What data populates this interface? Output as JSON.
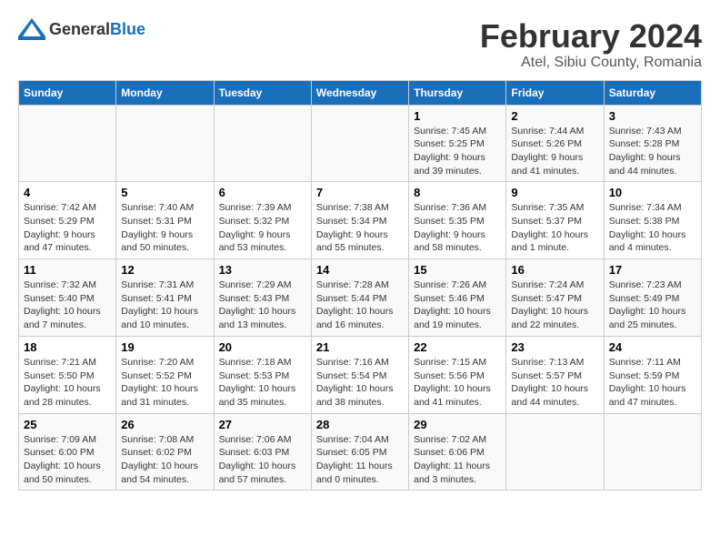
{
  "header": {
    "logo_general": "General",
    "logo_blue": "Blue",
    "title": "February 2024",
    "subtitle": "Atel, Sibiu County, Romania"
  },
  "days_of_week": [
    "Sunday",
    "Monday",
    "Tuesday",
    "Wednesday",
    "Thursday",
    "Friday",
    "Saturday"
  ],
  "weeks": [
    [
      {
        "day": "",
        "info": ""
      },
      {
        "day": "",
        "info": ""
      },
      {
        "day": "",
        "info": ""
      },
      {
        "day": "",
        "info": ""
      },
      {
        "day": "1",
        "info": "Sunrise: 7:45 AM\nSunset: 5:25 PM\nDaylight: 9 hours\nand 39 minutes."
      },
      {
        "day": "2",
        "info": "Sunrise: 7:44 AM\nSunset: 5:26 PM\nDaylight: 9 hours\nand 41 minutes."
      },
      {
        "day": "3",
        "info": "Sunrise: 7:43 AM\nSunset: 5:28 PM\nDaylight: 9 hours\nand 44 minutes."
      }
    ],
    [
      {
        "day": "4",
        "info": "Sunrise: 7:42 AM\nSunset: 5:29 PM\nDaylight: 9 hours\nand 47 minutes."
      },
      {
        "day": "5",
        "info": "Sunrise: 7:40 AM\nSunset: 5:31 PM\nDaylight: 9 hours\nand 50 minutes."
      },
      {
        "day": "6",
        "info": "Sunrise: 7:39 AM\nSunset: 5:32 PM\nDaylight: 9 hours\nand 53 minutes."
      },
      {
        "day": "7",
        "info": "Sunrise: 7:38 AM\nSunset: 5:34 PM\nDaylight: 9 hours\nand 55 minutes."
      },
      {
        "day": "8",
        "info": "Sunrise: 7:36 AM\nSunset: 5:35 PM\nDaylight: 9 hours\nand 58 minutes."
      },
      {
        "day": "9",
        "info": "Sunrise: 7:35 AM\nSunset: 5:37 PM\nDaylight: 10 hours\nand 1 minute."
      },
      {
        "day": "10",
        "info": "Sunrise: 7:34 AM\nSunset: 5:38 PM\nDaylight: 10 hours\nand 4 minutes."
      }
    ],
    [
      {
        "day": "11",
        "info": "Sunrise: 7:32 AM\nSunset: 5:40 PM\nDaylight: 10 hours\nand 7 minutes."
      },
      {
        "day": "12",
        "info": "Sunrise: 7:31 AM\nSunset: 5:41 PM\nDaylight: 10 hours\nand 10 minutes."
      },
      {
        "day": "13",
        "info": "Sunrise: 7:29 AM\nSunset: 5:43 PM\nDaylight: 10 hours\nand 13 minutes."
      },
      {
        "day": "14",
        "info": "Sunrise: 7:28 AM\nSunset: 5:44 PM\nDaylight: 10 hours\nand 16 minutes."
      },
      {
        "day": "15",
        "info": "Sunrise: 7:26 AM\nSunset: 5:46 PM\nDaylight: 10 hours\nand 19 minutes."
      },
      {
        "day": "16",
        "info": "Sunrise: 7:24 AM\nSunset: 5:47 PM\nDaylight: 10 hours\nand 22 minutes."
      },
      {
        "day": "17",
        "info": "Sunrise: 7:23 AM\nSunset: 5:49 PM\nDaylight: 10 hours\nand 25 minutes."
      }
    ],
    [
      {
        "day": "18",
        "info": "Sunrise: 7:21 AM\nSunset: 5:50 PM\nDaylight: 10 hours\nand 28 minutes."
      },
      {
        "day": "19",
        "info": "Sunrise: 7:20 AM\nSunset: 5:52 PM\nDaylight: 10 hours\nand 31 minutes."
      },
      {
        "day": "20",
        "info": "Sunrise: 7:18 AM\nSunset: 5:53 PM\nDaylight: 10 hours\nand 35 minutes."
      },
      {
        "day": "21",
        "info": "Sunrise: 7:16 AM\nSunset: 5:54 PM\nDaylight: 10 hours\nand 38 minutes."
      },
      {
        "day": "22",
        "info": "Sunrise: 7:15 AM\nSunset: 5:56 PM\nDaylight: 10 hours\nand 41 minutes."
      },
      {
        "day": "23",
        "info": "Sunrise: 7:13 AM\nSunset: 5:57 PM\nDaylight: 10 hours\nand 44 minutes."
      },
      {
        "day": "24",
        "info": "Sunrise: 7:11 AM\nSunset: 5:59 PM\nDaylight: 10 hours\nand 47 minutes."
      }
    ],
    [
      {
        "day": "25",
        "info": "Sunrise: 7:09 AM\nSunset: 6:00 PM\nDaylight: 10 hours\nand 50 minutes."
      },
      {
        "day": "26",
        "info": "Sunrise: 7:08 AM\nSunset: 6:02 PM\nDaylight: 10 hours\nand 54 minutes."
      },
      {
        "day": "27",
        "info": "Sunrise: 7:06 AM\nSunset: 6:03 PM\nDaylight: 10 hours\nand 57 minutes."
      },
      {
        "day": "28",
        "info": "Sunrise: 7:04 AM\nSunset: 6:05 PM\nDaylight: 11 hours\nand 0 minutes."
      },
      {
        "day": "29",
        "info": "Sunrise: 7:02 AM\nSunset: 6:06 PM\nDaylight: 11 hours\nand 3 minutes."
      },
      {
        "day": "",
        "info": ""
      },
      {
        "day": "",
        "info": ""
      }
    ]
  ]
}
